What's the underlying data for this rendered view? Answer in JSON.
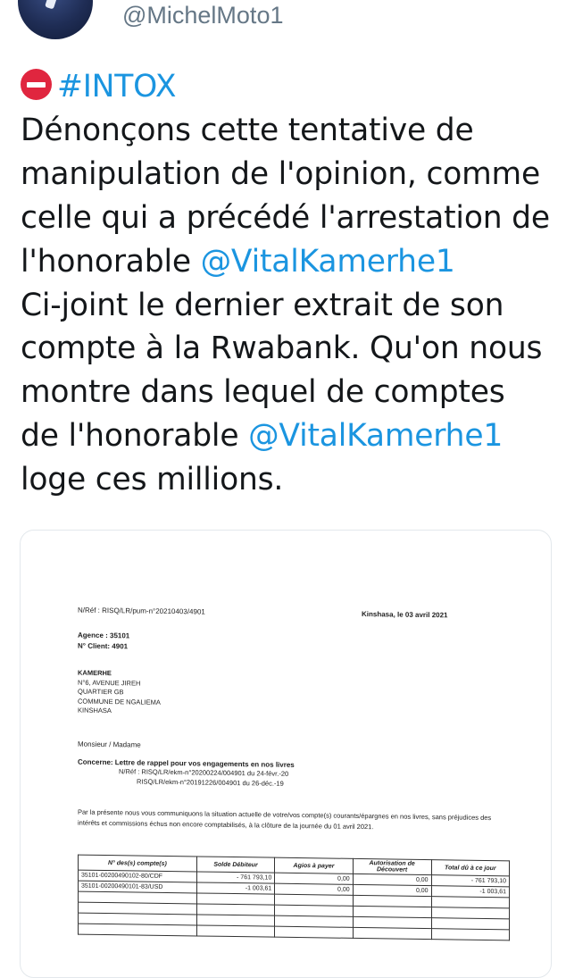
{
  "tweet": {
    "handle": "@MichelMoto1",
    "hashtag": "#INTOX",
    "lines": [
      "Dénonçons cette tentative de",
      "manipulation de l'opinion, comme",
      "celle qui a précédé l'arrestation de",
      "l'honorable ",
      "Ci-joint le dernier extrait de son",
      "compte à la Rwabank. Qu'on nous",
      "montre dans lequel de comptes",
      "de l'honorable ",
      "loge ces millions."
    ],
    "mention_1": "@VitalKamerhe1",
    "mention_2": "@VitalKamerhe1",
    "icons": {
      "emoji": "no-entry-icon"
    },
    "colors": {
      "link": "#1b95e0",
      "text": "#14171a",
      "handle": "#657786",
      "no_entry": "#e0263f"
    }
  },
  "document": {
    "ref": "N/Réf : RISQ/LR/pum-n°20210403/4901",
    "date": "Kinshasa, le 03 avril 2021",
    "agence": "Agence : 35101",
    "client": "N° Client:  4901",
    "address": [
      "KAMERHE",
      "N°6, AVENUE JIREH",
      "QUARTIER GB",
      "COMMUNE DE NGALIEMA",
      "KINSHASA"
    ],
    "salutation": "Monsieur / Madame",
    "concern": "Concerne: Lettre de rappel pour vos engagements en nos livres",
    "refs": [
      "N/Réf : RISQ/LR/ekm-n°20200224/004901 du 24-févr.-20",
      "RISQ/LR/ekm-n°20191226/004901 du 26-déc.-19"
    ],
    "paragraph": "Par la présente nous vous communiquons la situation actuelle de votre/vos compte(s) courants/épargnes en nos livres, sans préjudices des intérêts et commissions échus non encore comptabilisés, à la clôture de la journée du 01 avril 2021.",
    "table": {
      "headers": [
        "N° des(s) compte(s)",
        "Solde Débiteur",
        "Agios à payer",
        "Autorisation de Découvert",
        "Total dû à ce jour"
      ],
      "rows": [
        [
          "35101-00200490102-80/CDF",
          "- 761 793,10",
          "0,00",
          "0,00",
          "- 761 793,10"
        ],
        [
          "35101-00200490101-83/USD",
          "-1 003,61",
          "0,00",
          "0,00",
          "-1 003,61"
        ],
        [
          "",
          "",
          "",
          "",
          ""
        ],
        [
          "",
          "",
          "",
          "",
          ""
        ],
        [
          "",
          "",
          "",
          "",
          ""
        ],
        [
          "",
          "",
          "",
          "",
          ""
        ]
      ]
    }
  }
}
